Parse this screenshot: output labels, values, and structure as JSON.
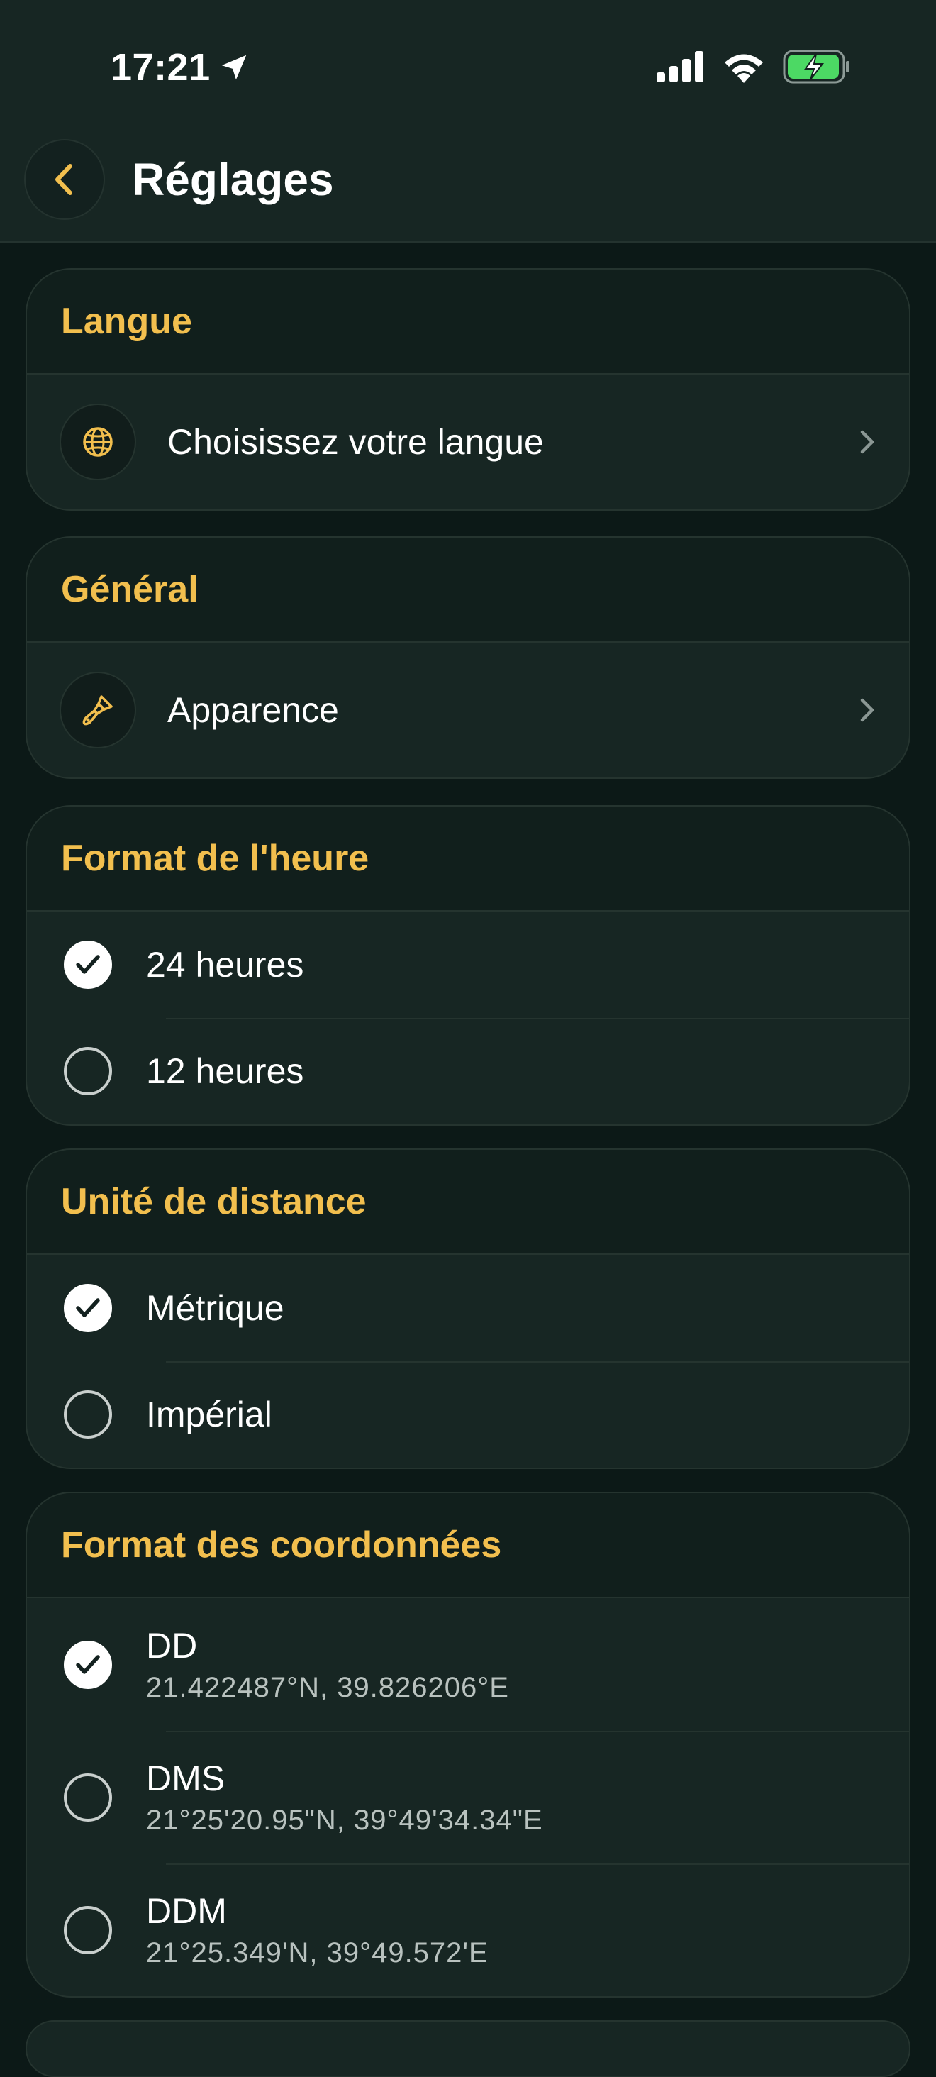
{
  "status_bar": {
    "time": "17:21"
  },
  "header": {
    "title": "Réglages"
  },
  "sections": {
    "language": {
      "title": "Langue",
      "item_label": "Choisissez votre langue"
    },
    "general": {
      "title": "Général",
      "item_label": "Apparence"
    },
    "time_format": {
      "title": "Format de l'heure",
      "options": [
        {
          "label": "24 heures",
          "selected": true
        },
        {
          "label": "12 heures",
          "selected": false
        }
      ]
    },
    "distance_unit": {
      "title": "Unité de distance",
      "options": [
        {
          "label": "Métrique",
          "selected": true
        },
        {
          "label": "Impérial",
          "selected": false
        }
      ]
    },
    "coord_format": {
      "title": "Format des coordonnées",
      "options": [
        {
          "label": "DD",
          "example": "21.422487°N, 39.826206°E",
          "selected": true
        },
        {
          "label": "DMS",
          "example": "21°25'20.95\"N, 39°49'34.34\"E",
          "selected": false
        },
        {
          "label": "DDM",
          "example": "21°25.349'N, 39°49.572'E",
          "selected": false
        }
      ]
    }
  },
  "colors": {
    "accent": "#f2bf4e",
    "background": "#0c1917",
    "card": "#172623",
    "card_header": "#111f1c",
    "battery": "#4cd964"
  },
  "icons": {
    "location": "location-arrow-icon",
    "signal": "cellular-signal-icon",
    "wifi": "wifi-icon",
    "battery": "battery-charging-icon",
    "back": "chevron-left-icon",
    "language": "globe-icon",
    "appearance": "paintbrush-icon",
    "nav": "chevron-right-icon",
    "selected": "checkmark-icon"
  }
}
